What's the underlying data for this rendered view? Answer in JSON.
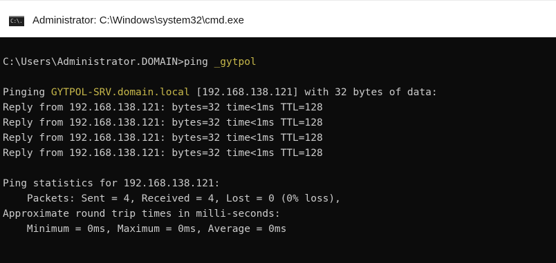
{
  "window": {
    "title": "Administrator: C:\\Windows\\system32\\cmd.exe",
    "icon": "cmd-icon",
    "icon_text": "C:\\."
  },
  "colors": {
    "console_background": "#0c0c0c",
    "console_text": "#cccccc",
    "highlight_text": "#c6b74a",
    "titlebar_background": "#ffffff"
  },
  "console": {
    "prompt": "C:\\Users\\Administrator.DOMAIN>",
    "command": "ping ",
    "command_arg": "_gytpol",
    "pinging_prefix": "Pinging ",
    "pinging_host": "GYTPOL-SRV.domain.local",
    "pinging_suffix": " [192.168.138.121] with 32 bytes of data:",
    "replies": [
      "Reply from 192.168.138.121: bytes=32 time<1ms TTL=128",
      "Reply from 192.168.138.121: bytes=32 time<1ms TTL=128",
      "Reply from 192.168.138.121: bytes=32 time<1ms TTL=128",
      "Reply from 192.168.138.121: bytes=32 time<1ms TTL=128"
    ],
    "stats_header": "Ping statistics for 192.168.138.121:",
    "packets": "    Packets: Sent = 4, Received = 4, Lost = 0 (0% loss),",
    "rtt_header": "Approximate round trip times in milli-seconds:",
    "rtt_values": "    Minimum = 0ms, Maximum = 0ms, Average = 0ms"
  }
}
